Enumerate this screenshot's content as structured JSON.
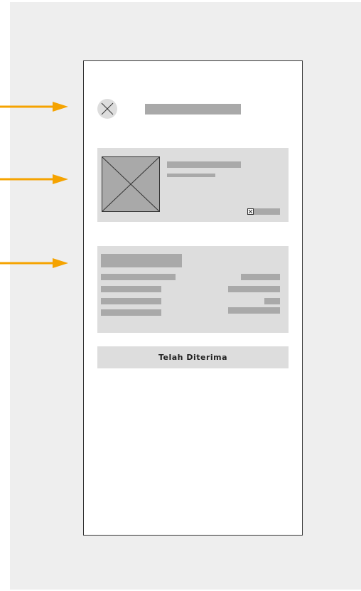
{
  "button": {
    "label": "Telah Diterima"
  },
  "colors": {
    "background": "#eeeeee",
    "screen": "#ffffff",
    "card": "#dddddd",
    "placeholder": "#a9a9a9",
    "arrow": "#f5a300"
  },
  "icons": {
    "arrows": [
      "arrow-right-icon",
      "arrow-right-icon",
      "arrow-right-icon"
    ],
    "header": "close-icon",
    "product_image": "image-placeholder-icon",
    "quantity": "close-icon"
  }
}
